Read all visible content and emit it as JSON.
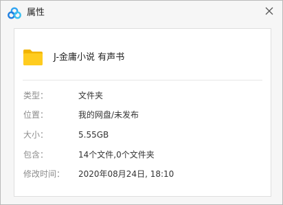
{
  "window": {
    "title": "属性",
    "logo_icon": "baidu-netdisk-cloud-icon",
    "close_icon": "close-icon"
  },
  "item": {
    "icon": "folder-icon",
    "icon_color": "#ffc400",
    "name": "J-金庸小说 有声书"
  },
  "properties": [
    {
      "label": "类型：",
      "value": "文件夹"
    },
    {
      "label": "位置：",
      "value": "我的网盘/未发布"
    },
    {
      "label": "大小：",
      "value": "5.55GB"
    },
    {
      "label": "包含：",
      "value": "14个文件,0个文件夹"
    },
    {
      "label": "修改时间：",
      "value": "2020年08月24日, 18:10"
    }
  ]
}
